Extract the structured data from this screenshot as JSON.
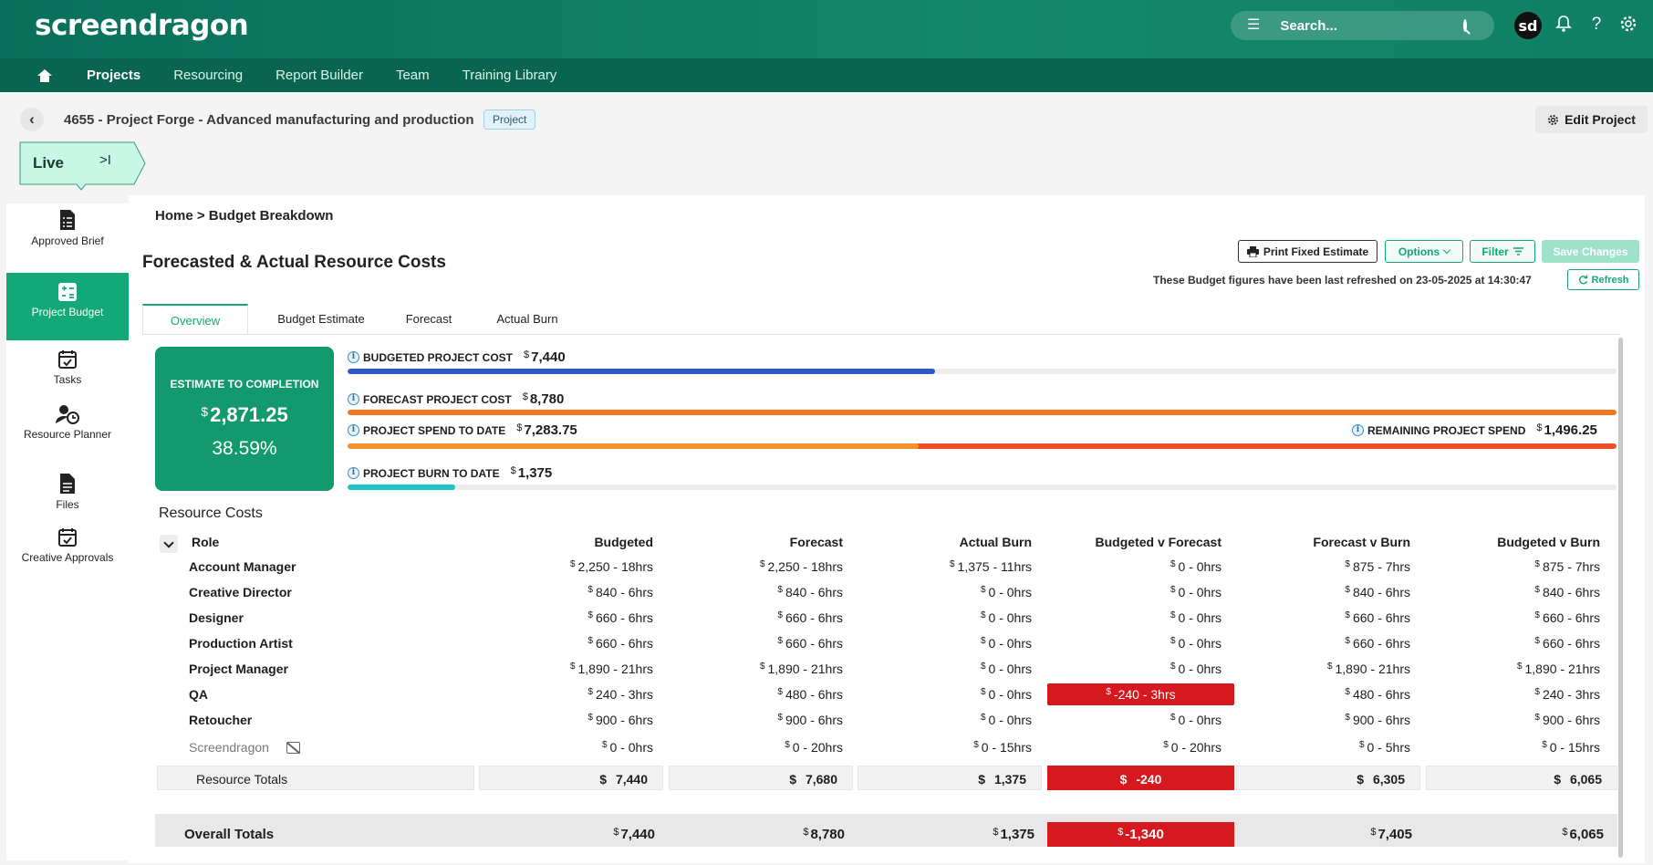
{
  "app": {
    "logo": "screendragon",
    "search_placeholder": "Search...",
    "avatar": "sd",
    "nav": [
      "Projects",
      "Resourcing",
      "Report Builder",
      "Team",
      "Training Library"
    ]
  },
  "project": {
    "title": "4655 - Project Forge - Advanced manufacturing and production",
    "tag": "Project",
    "edit_label": "Edit Project",
    "status": "Live",
    "status_toggle": ">I"
  },
  "sidebar": [
    {
      "label": "Approved Brief"
    },
    {
      "label": "Project Budget"
    },
    {
      "label": "Tasks"
    },
    {
      "label": "Resource Planner"
    },
    {
      "label": "Files"
    },
    {
      "label": "Creative Approvals"
    }
  ],
  "breadcrumb": {
    "home": "Home",
    "sep": ">",
    "current": "Budget Breakdown"
  },
  "page": {
    "title": "Forecasted & Actual Resource Costs",
    "print_label": "Print Fixed Estimate",
    "options_label": "Options",
    "filter_label": "Filter",
    "save_label": "Save Changes",
    "refreshed_text": "These Budget figures have been last refreshed on 23-05-2025 at 14:30:47",
    "refresh_label": "Refresh"
  },
  "tabs": [
    "Overview",
    "Budget Estimate",
    "Forecast",
    "Actual Burn"
  ],
  "summary": {
    "etc_label": "ESTIMATE TO COMPLETION",
    "currency": "$",
    "etc_value": "2,871.25",
    "etc_percent": "38.59%",
    "budgeted_label": "BUDGETED PROJECT COST",
    "budgeted_value": "7,440",
    "forecast_label": "FORECAST PROJECT COST",
    "forecast_value": "8,780",
    "spend_label": "PROJECT SPEND TO DATE",
    "spend_value": "7,283.75",
    "remaining_label": "REMAINING PROJECT SPEND",
    "remaining_value": "1,496.25",
    "burn_label": "PROJECT BURN TO DATE",
    "burn_value": "1,375",
    "bar_colors": {
      "budgeted": "#2f58c5",
      "forecast": "#f07820",
      "spend": "#f7932f",
      "remaining": "#ef4d23",
      "burn": "#1ec4c4"
    },
    "bar_fractions": {
      "budgeted": 0.463,
      "forecast": 1.0,
      "spend": 0.45,
      "burn": 0.085
    }
  },
  "resource_costs": {
    "title": "Resource Costs",
    "headers": [
      "Role",
      "Budgeted",
      "Forecast",
      "Actual Burn",
      "Budgeted v Forecast",
      "Forecast v Burn",
      "Budgeted v Burn"
    ],
    "rows": [
      {
        "role": "Account Manager",
        "values": [
          "2,250 - 18hrs",
          "2,250 - 18hrs",
          "1,375 - 11hrs",
          "0 - 0hrs",
          "875 - 7hrs",
          "875 - 7hrs"
        ],
        "negative": false
      },
      {
        "role": "Creative Director",
        "values": [
          "840 - 6hrs",
          "840 - 6hrs",
          "0 - 0hrs",
          "0 - 0hrs",
          "840 - 6hrs",
          "840 - 6hrs"
        ],
        "negative": false
      },
      {
        "role": "Designer",
        "values": [
          "660 - 6hrs",
          "660 - 6hrs",
          "0 - 0hrs",
          "0 - 0hrs",
          "660 - 6hrs",
          "660 - 6hrs"
        ],
        "negative": false
      },
      {
        "role": "Production Artist",
        "values": [
          "660 - 6hrs",
          "660 - 6hrs",
          "0 - 0hrs",
          "0 - 0hrs",
          "660 - 6hrs",
          "660 - 6hrs"
        ],
        "negative": false
      },
      {
        "role": "Project Manager",
        "values": [
          "1,890 - 21hrs",
          "1,890 - 21hrs",
          "0 - 0hrs",
          "0 - 0hrs",
          "1,890 - 21hrs",
          "1,890 - 21hrs"
        ],
        "negative": false
      },
      {
        "role": "QA",
        "values": [
          "240 - 3hrs",
          "480 - 6hrs",
          "0 - 0hrs",
          "-240 - 3hrs",
          "480 - 6hrs",
          "240 - 3hrs"
        ],
        "negative": true
      },
      {
        "role": "Retoucher",
        "values": [
          "900 - 6hrs",
          "900 - 6hrs",
          "0 - 0hrs",
          "0 - 0hrs",
          "900 - 6hrs",
          "900 - 6hrs"
        ],
        "negative": false
      },
      {
        "role": "Screendragon",
        "values": [
          "0 - 0hrs",
          "0 - 20hrs",
          "0 - 15hrs",
          "0 - 20hrs",
          "0 - 5hrs",
          "0 - 15hrs"
        ],
        "negative": false
      }
    ],
    "totals_label": "Resource Totals",
    "totals": [
      "7,440",
      "7,680",
      "1,375",
      "-240",
      "6,305",
      "6,065"
    ],
    "overall_label": "Overall Totals",
    "overall": [
      "7,440",
      "8,780",
      "1,375",
      "-1,340",
      "7,405",
      "6,065"
    ],
    "negative_color": "#d6181f"
  }
}
